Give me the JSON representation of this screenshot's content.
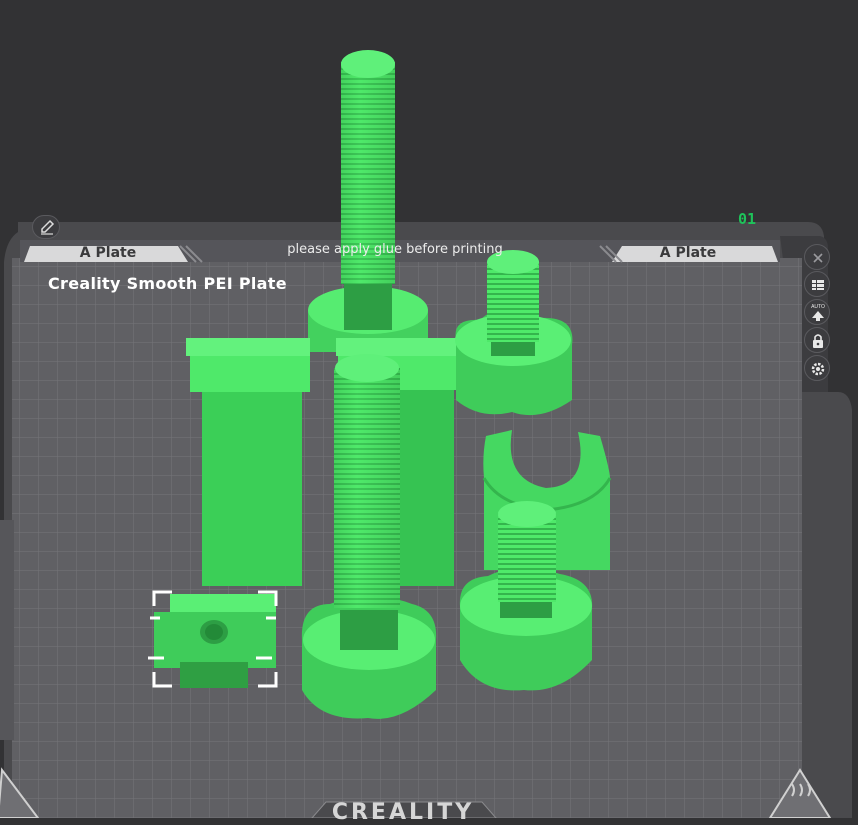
{
  "plate": {
    "number": "01",
    "name": "Creality Smooth PEI Plate",
    "tab_left_label": "A Plate",
    "tab_right_label": "A Plate",
    "notice": "please apply glue before printing",
    "brand": "CREALITY"
  },
  "toolbar": {
    "icons": [
      "pencil-icon",
      "close-icon",
      "list-icon",
      "auto-orient-icon",
      "lock-icon",
      "gear-icon"
    ],
    "auto_label": "AUTO"
  },
  "colors": {
    "model_green": "#4fe96a",
    "plate_grey": "#5f5f62",
    "background": "#323234",
    "selection": "#ffffff",
    "accent_green": "#1ec35a"
  }
}
